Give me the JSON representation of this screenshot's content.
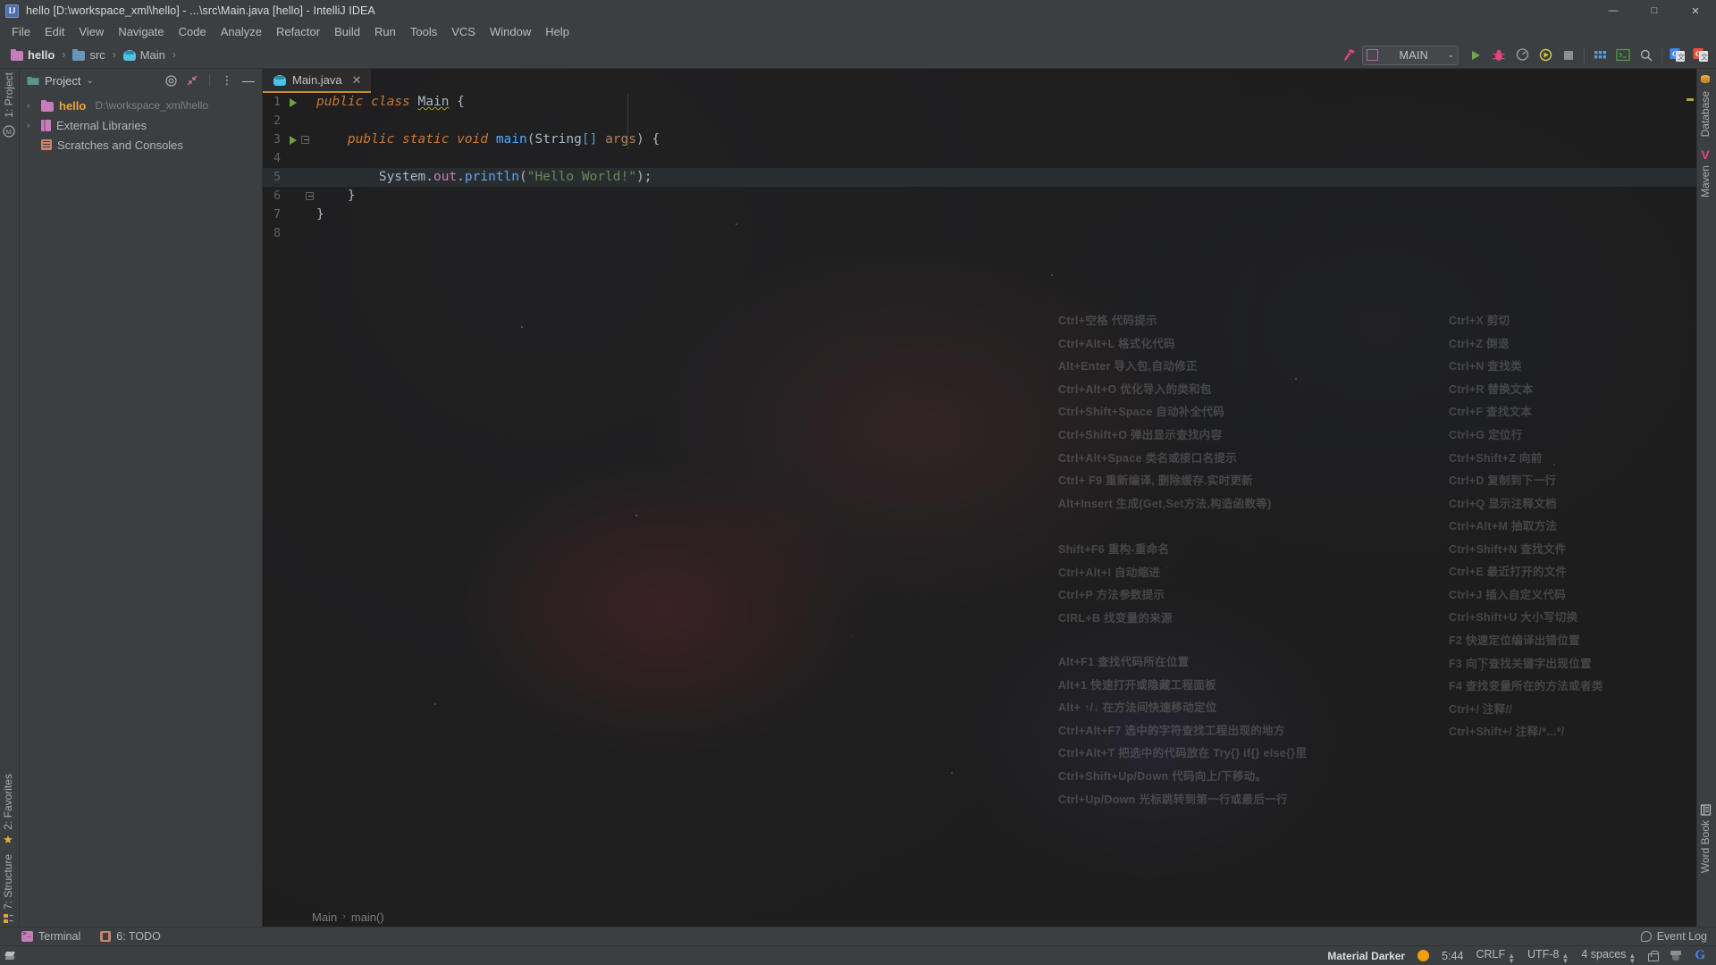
{
  "window": {
    "title": "hello [D:\\workspace_xml\\hello] - ...\\src\\Main.java [hello] - IntelliJ IDEA",
    "app_icon_text": "IJ",
    "minimize": "—",
    "maximize": "□",
    "close": "✕"
  },
  "menu": {
    "items": [
      {
        "label": "File"
      },
      {
        "label": "Edit"
      },
      {
        "label": "View"
      },
      {
        "label": "Navigate"
      },
      {
        "label": "Code"
      },
      {
        "label": "Analyze"
      },
      {
        "label": "Refactor"
      },
      {
        "label": "Build"
      },
      {
        "label": "Run"
      },
      {
        "label": "Tools"
      },
      {
        "label": "VCS"
      },
      {
        "label": "Window"
      },
      {
        "label": "Help"
      }
    ]
  },
  "breadcrumbs": {
    "items": [
      {
        "label": "hello",
        "icon": "folder-icon"
      },
      {
        "label": "src",
        "icon": "source-folder-icon"
      },
      {
        "label": "Main",
        "icon": "java-class-icon"
      }
    ],
    "separator": "›"
  },
  "toolbar": {
    "build_icon": "hammer-icon",
    "run_config": {
      "name": "MAIN",
      "arrow": "⌄"
    },
    "buttons": [
      {
        "name": "run-button",
        "icon": "play-icon"
      },
      {
        "name": "debug-button",
        "icon": "bug-icon"
      },
      {
        "name": "run-with-coverage-button",
        "icon": "coverage-icon"
      },
      {
        "name": "profile-button",
        "icon": "profiler-icon"
      },
      {
        "name": "stop-button",
        "icon": "stop-icon"
      },
      {
        "name": "app-grid-button",
        "icon": "grid-icon"
      },
      {
        "name": "terminal-button",
        "icon": "terminal-icon"
      },
      {
        "name": "search-everywhere-button",
        "icon": "search-icon"
      },
      {
        "name": "translate-button",
        "icon": "google-translate-icon"
      },
      {
        "name": "translate-alt-button",
        "icon": "translate-alt-icon"
      }
    ]
  },
  "left_strip": {
    "project_label": "1: Project",
    "favorites_label": "2: Favorites",
    "structure_label": "7: Structure"
  },
  "right_strip": {
    "database_label": "Database",
    "maven_label": "Maven",
    "word_book_label": "Word Book"
  },
  "project_panel": {
    "title": "Project",
    "chevron": "⌄",
    "locate_icon": "target-icon",
    "collapse_icon": "collapse-all-icon",
    "options_icon": "more-options-icon",
    "hide_icon": "hide-panel-icon",
    "tree": [
      {
        "label": "hello",
        "path": "D:\\workspace_xml\\hello",
        "arrow": "›",
        "icon": "module-folder-icon",
        "bold": true
      },
      {
        "label": "External Libraries",
        "path": "",
        "arrow": "›",
        "icon": "libraries-icon",
        "bold": false
      },
      {
        "label": "Scratches and Consoles",
        "path": "",
        "arrow": "",
        "icon": "scratches-icon",
        "bold": false
      }
    ]
  },
  "editor": {
    "tab": {
      "label": "Main.java",
      "close": "✕",
      "icon": "java-class-icon"
    },
    "lines": [
      {
        "num": "1",
        "gutter_run": true,
        "gutter_fold": false,
        "text": "public class Main {",
        "highlight": false
      },
      {
        "num": "2",
        "gutter_run": false,
        "gutter_fold": false,
        "text": "",
        "highlight": false
      },
      {
        "num": "3",
        "gutter_run": true,
        "gutter_fold": true,
        "text": "    public static void main(String[] args) {",
        "highlight": false
      },
      {
        "num": "4",
        "gutter_run": false,
        "gutter_fold": false,
        "text": "",
        "highlight": false
      },
      {
        "num": "5",
        "gutter_run": false,
        "gutter_fold": false,
        "text": "        System.out.println(\"Hello World!\");",
        "highlight": true
      },
      {
        "num": "6",
        "gutter_run": false,
        "gutter_fold": true,
        "text": "    }",
        "highlight": false
      },
      {
        "num": "7",
        "gutter_run": false,
        "gutter_fold": false,
        "text": "}",
        "highlight": false
      },
      {
        "num": "8",
        "gutter_run": false,
        "gutter_fold": false,
        "text": "",
        "highlight": false
      }
    ],
    "breadcrumb": {
      "class": "Main",
      "method": "main()",
      "separator": "›"
    }
  },
  "watermark": {
    "left_group_1": [
      "Ctrl+空格  代码提示",
      "Ctrl+Alt+L  格式化代码",
      "Alt+Enter 导入包,自动修正",
      "Ctrl+Alt+O  优化导入的类和包",
      "Ctrl+Shift+Space 自动补全代码",
      "Ctrl+Shift+O  弹出显示查找内容",
      "Ctrl+Alt+Space  类名或接口名提示",
      " Ctrl+ F9 重新编译, 删除缓存.实时更新",
      "Alt+Insert  生成(Get,Set方法,构造函数等)"
    ],
    "left_group_2": [
      "Shift+F6  重构-重命名",
      "Ctrl+Alt+I  自动缩进",
      "Ctrl+P   方法参数提示",
      "CIRL+B   找变量的来源"
    ],
    "left_group_3": [
      "Alt+F1 查找代码所在位置",
      "Alt+1 快速打开或隐藏工程面板",
      "Alt+ ↑/↓ 在方法间快速移动定位",
      "Ctrl+Alt+F7  选中的字符查找工程出现的地方",
      "Ctrl+Alt+T  把选中的代码放在 Try{} if{} else{}里",
      "Ctrl+Shift+Up/Down 代码向上/下移动。",
      "Ctrl+Up/Down  光标跳转到第一行或最后一行"
    ],
    "right_group_1": [
      "Ctrl+X   剪切",
      "Ctrl+Z   倒退",
      "Ctrl+N   查找类",
      "Ctrl+R 替换文本",
      "Ctrl+F 查找文本",
      "Ctrl+G   定位行",
      "Ctrl+Shift+Z  向前",
      "Ctrl+D  复制到下一行",
      "Ctrl+Q   显示注释文档"
    ],
    "right_group_2": [
      "Ctrl+Alt+M  抽取方法",
      "Ctrl+Shift+N 查找文件",
      "Ctrl+E 最近打开的文件",
      "Ctrl+J   插入自定义代码",
      "Ctrl+Shift+U 大小写切换",
      "F2  快速定位编译出错位置",
      "F3  向下查找关键字出现位置",
      "F4  查找变量所在的方法或者类",
      "Ctrl+/   注释//",
      "Ctrl+Shift+/  注释/*...*/"
    ]
  },
  "bottom_bar": {
    "terminal_label": "Terminal",
    "todo_label": "6: TODO",
    "event_log_label": "Event Log"
  },
  "status_bar": {
    "theme": "Material Darker",
    "time": "5:44",
    "line_separator": "CRLF",
    "encoding": "UTF-8",
    "indent": "4 spaces",
    "lock_icon": "unlocked-icon",
    "hat_icon": "inspector-hat-icon",
    "google_icon": "google-icon",
    "stepper": "⌃⌄"
  },
  "colors": {
    "accent_orange": "#c98b2a",
    "panel_bg": "#3c3f41",
    "editor_bg": "#212121",
    "keyword": "#cc7832",
    "string": "#6a8759",
    "type": "#6897bb",
    "method": "#56a8f5",
    "field": "#c77dbb"
  }
}
